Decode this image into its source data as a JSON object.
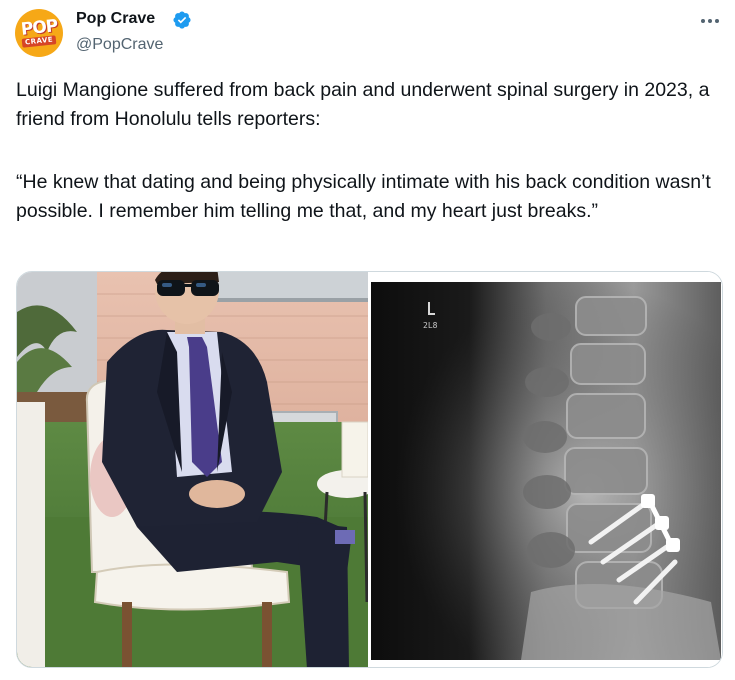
{
  "account": {
    "display_name": "Pop Crave",
    "handle": "@PopCrave",
    "verified": true,
    "avatar": {
      "logo_top": "POP",
      "logo_bottom": "CRAVE",
      "background": "#f6a817"
    }
  },
  "tweet": {
    "paragraphs": [
      "Luigi Mangione suffered from back pain and underwent spinal surgery in 2023, a friend from Honolulu tells reporters:",
      "“He knew that dating and being physically intimate with his back condition wasn’t possible. I remember him telling me that, and my heart just breaks.”"
    ]
  },
  "media": {
    "count": 2,
    "images": [
      {
        "kind": "photo",
        "icon": "person-in-suit-photo"
      },
      {
        "kind": "x-ray",
        "icon": "spine-xray-photo",
        "marker_text": "L",
        "corner_text": "2L8"
      }
    ]
  },
  "icons": {
    "verified": "verified-badge-icon",
    "more": "more-options-icon"
  },
  "colors": {
    "primary_text": "#0f1419",
    "secondary_text": "#536471",
    "verified_blue": "#1d9bf0",
    "border": "#cfd9de"
  }
}
